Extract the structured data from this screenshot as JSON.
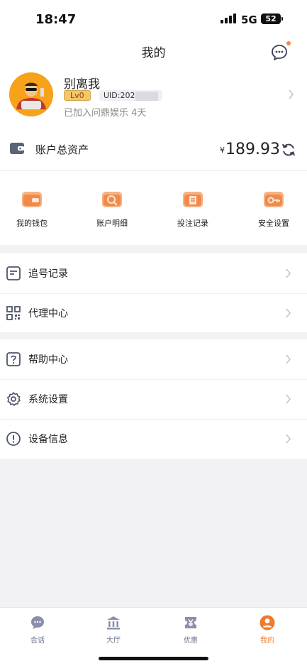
{
  "status_bar": {
    "time": "18:47",
    "network": "5G",
    "battery": "52"
  },
  "header": {
    "title": "我的"
  },
  "profile": {
    "username": "别离我",
    "level": "Lv0",
    "uid_prefix": "UID:202",
    "joined_text": "已加入问鼎娱乐 4天"
  },
  "assets": {
    "label": "账户总资产",
    "currency": "¥",
    "amount": "189.93"
  },
  "quick_actions": [
    {
      "label": "我的钱包",
      "icon": "wallet-icon"
    },
    {
      "label": "账户明细",
      "icon": "account-details-icon"
    },
    {
      "label": "投注记录",
      "icon": "bet-record-icon"
    },
    {
      "label": "安全设置",
      "icon": "security-key-icon"
    }
  ],
  "menu_group_1": [
    {
      "label": "追号记录",
      "icon": "document-lines-icon"
    },
    {
      "label": "代理中心",
      "icon": "qr-grid-icon"
    }
  ],
  "menu_group_2": [
    {
      "label": "帮助中心",
      "icon": "question-box-icon"
    },
    {
      "label": "系统设置",
      "icon": "gear-icon"
    },
    {
      "label": "设备信息",
      "icon": "info-circle-icon"
    }
  ],
  "tabs": [
    {
      "label": "会话",
      "icon": "chat-icon"
    },
    {
      "label": "大厅",
      "icon": "bank-icon"
    },
    {
      "label": "优惠",
      "icon": "yen-coupon-icon"
    },
    {
      "label": "我的",
      "icon": "user-icon",
      "active": true
    }
  ],
  "colors": {
    "accent": "#f07b2c",
    "tab_inactive": "#6f7590",
    "icon_gray": "#5a6070",
    "background": "#f2f2f4"
  }
}
